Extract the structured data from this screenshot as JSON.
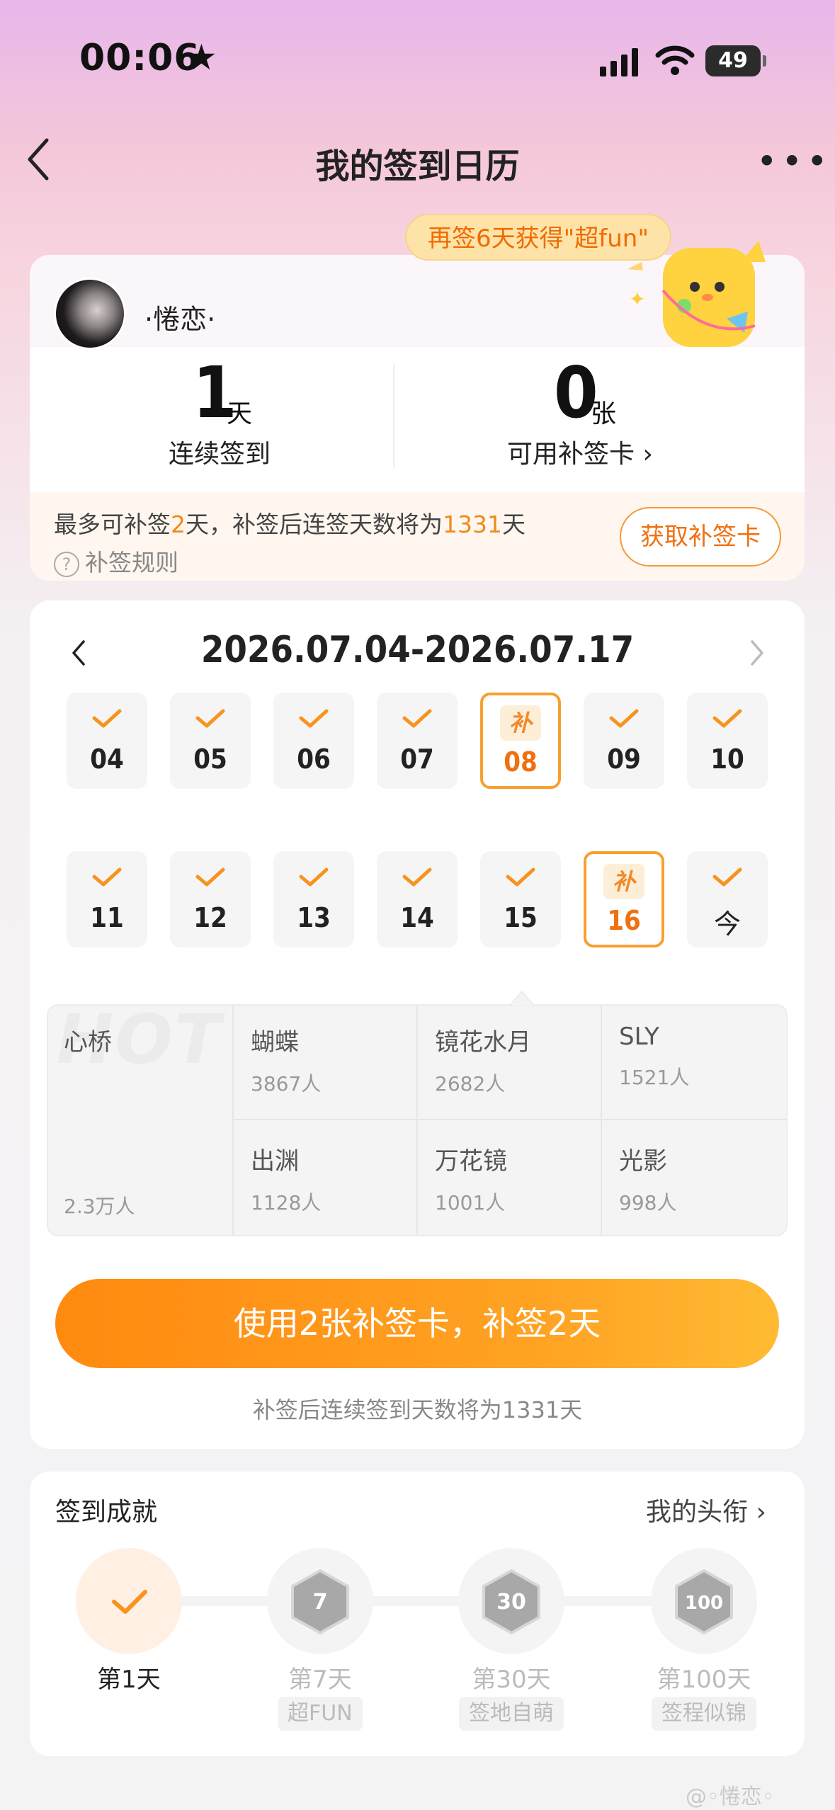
{
  "status": {
    "time": "00:06",
    "star": "★",
    "battery": "49"
  },
  "nav": {
    "title": "我的签到日历",
    "back_icon": "chevron-left-icon",
    "more": "•••"
  },
  "profile": {
    "username": "·惓恋·",
    "tooltip": "再签6天获得\"超fun\"",
    "streak": {
      "value": "1",
      "unit": "天",
      "label": "连续签到"
    },
    "cards": {
      "value": "0",
      "unit": "张",
      "label": "可用补签卡 ›"
    },
    "info_prefix": "最多可补签",
    "info_days": "2",
    "info_mid": "天，补签后连签天数将为",
    "info_total": "1331",
    "info_suffix": "天",
    "rule_q": "?",
    "rule_label": "补签规则",
    "get_card_button": "获取补签卡"
  },
  "calendar": {
    "range": "2026.07.04-2026.07.17",
    "makeup_label": "补",
    "days": [
      {
        "label": "04",
        "state": "signed"
      },
      {
        "label": "05",
        "state": "signed"
      },
      {
        "label": "06",
        "state": "signed"
      },
      {
        "label": "07",
        "state": "signed"
      },
      {
        "label": "08",
        "state": "makeup"
      },
      {
        "label": "09",
        "state": "signed"
      },
      {
        "label": "10",
        "state": "signed"
      },
      {
        "label": "11",
        "state": "signed"
      },
      {
        "label": "12",
        "state": "signed"
      },
      {
        "label": "13",
        "state": "signed"
      },
      {
        "label": "14",
        "state": "signed"
      },
      {
        "label": "15",
        "state": "signed"
      },
      {
        "label": "16",
        "state": "makeup"
      },
      {
        "label": "今",
        "state": "today"
      }
    ]
  },
  "hot": {
    "watermark": "HOT",
    "first": {
      "name": "心桥",
      "count": "2.3万人"
    },
    "items": [
      {
        "name": "蝴蝶",
        "count": "3867人"
      },
      {
        "name": "镜花水月",
        "count": "2682人"
      },
      {
        "name": "SLY",
        "count": "1521人"
      },
      {
        "name": "出渊",
        "count": "1128人"
      },
      {
        "name": "万花镜",
        "count": "1001人"
      },
      {
        "name": "光影",
        "count": "998人"
      }
    ]
  },
  "action": {
    "button": "使用2张补签卡，补签2天",
    "note": "补签后连续签到天数将为1331天"
  },
  "achievements": {
    "title": "签到成就",
    "link": "我的头衔 ›",
    "items": [
      {
        "label": "第1天",
        "tag": "",
        "state": "done"
      },
      {
        "label": "第7天",
        "tag": "超FUN",
        "state": "todo"
      },
      {
        "label": "第30天",
        "tag": "签地自萌",
        "state": "todo"
      },
      {
        "label": "第100天",
        "tag": "签程似锦",
        "state": "todo"
      }
    ]
  },
  "footer": {
    "watermark": "@◦惓恋◦"
  },
  "colors": {
    "accent": "#ff8a10",
    "accent_text": "#f07010",
    "check": "#f7931e"
  }
}
